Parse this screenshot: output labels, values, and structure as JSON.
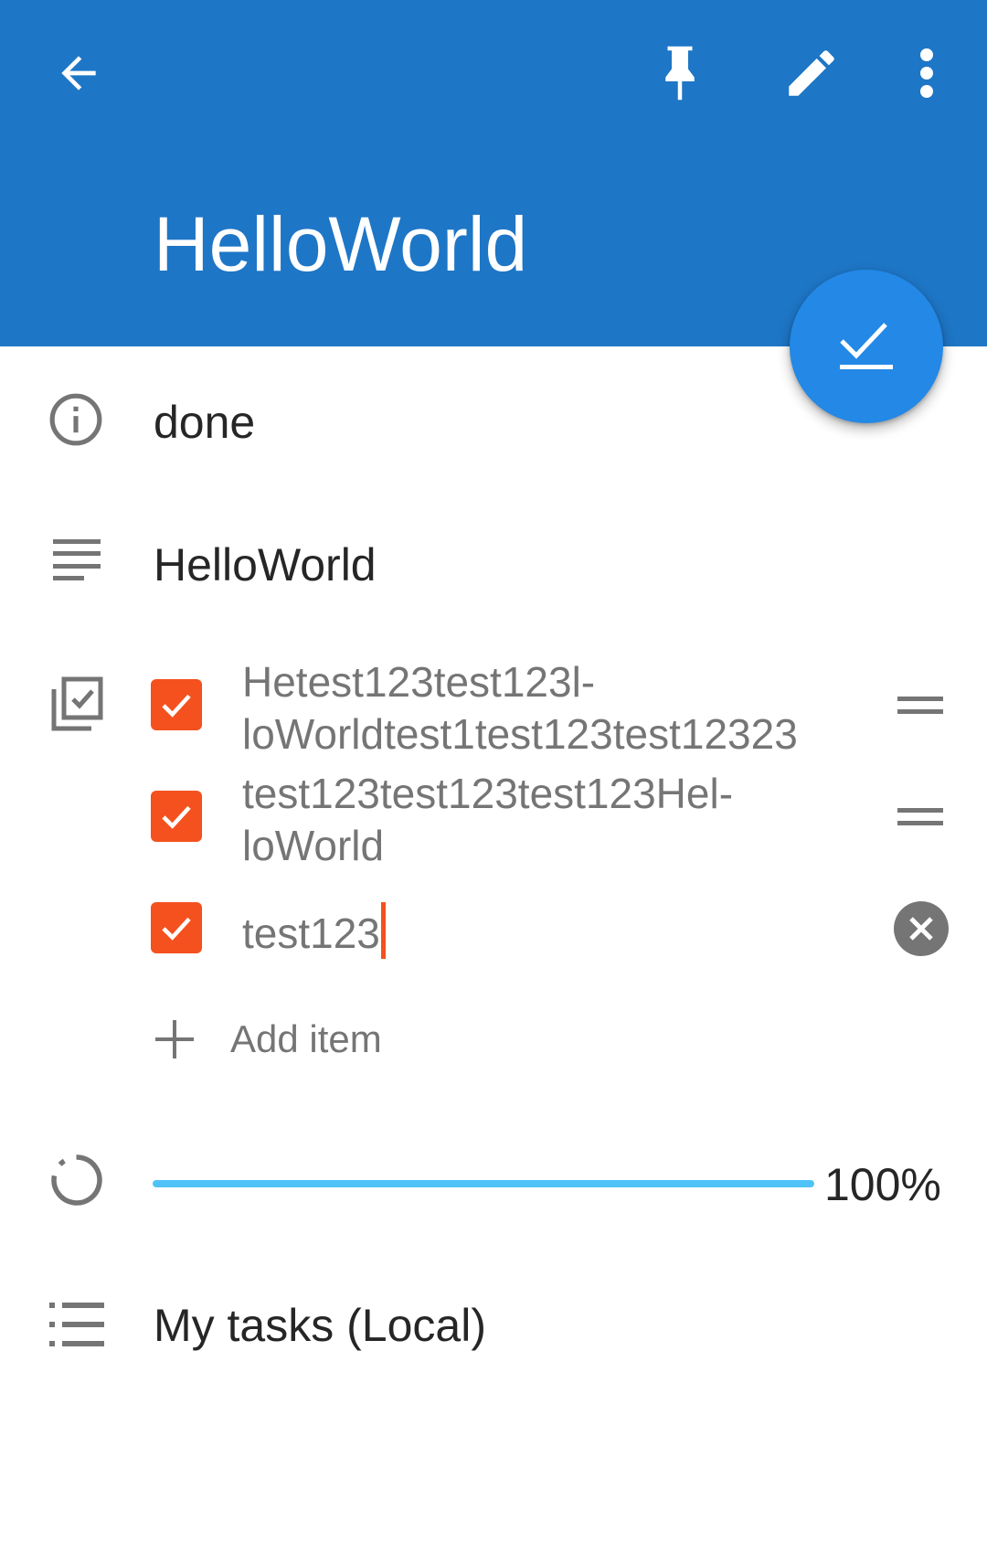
{
  "toolbar": {
    "icons": [
      "arrow-back-icon",
      "pin-icon",
      "edit-icon",
      "more-vert-icon"
    ],
    "title": "HelloWorld",
    "background": "#1e76c6"
  },
  "fab": {
    "icon": "check-done-icon",
    "color": "#2388e6"
  },
  "status": {
    "icon": "info-icon",
    "value": "done"
  },
  "description": {
    "icon": "notes-icon",
    "value": "HelloWorld"
  },
  "checklist": {
    "icon": "checklist-icon",
    "checkbox_color": "#f4511e",
    "items": [
      {
        "text": "Hetest123test123l-loWorldtest1test123test12323",
        "checked": true
      },
      {
        "text": "test123test123test123Hel-loWorld",
        "checked": true
      },
      {
        "text": "test123",
        "checked": true,
        "editing": true
      }
    ],
    "add_label": "Add item"
  },
  "progress": {
    "icon": "progress-icon",
    "value": 1.0,
    "label": "100%",
    "color": "#4fc3f7"
  },
  "list": {
    "icon": "list-icon",
    "value": "My tasks (Local)"
  }
}
